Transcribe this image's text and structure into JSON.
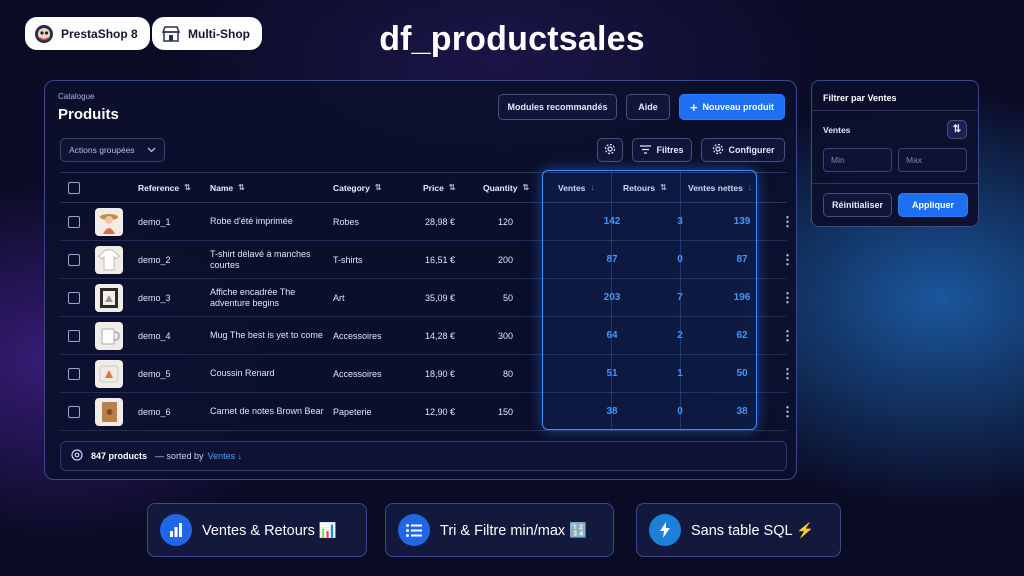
{
  "badges": [
    {
      "label": "PrestaShop 8",
      "icon": "prestashop-logo"
    },
    {
      "label": "Multi-Shop",
      "icon": "store-icon"
    }
  ],
  "main_title": "df_productsales",
  "panel": {
    "breadcrumb": "Catalogue",
    "title": "Produits",
    "buttons": {
      "modules": "Modules recommandés",
      "help": "Aide",
      "new_product": "Nouveau produit"
    },
    "bulk_actions": "Actions groupées",
    "toolbar": {
      "filters": "Filtres",
      "configure": "Configurer"
    }
  },
  "table": {
    "columns": [
      "Reference",
      "Name",
      "Category",
      "Price",
      "Quantity",
      "Ventes",
      "Retours",
      "Ventes nettes"
    ],
    "rows": [
      {
        "ref": "demo_1",
        "name": "Robe d'été imprimée",
        "category": "Robes",
        "price": "28,98 €",
        "qty": "120",
        "ventes": "142",
        "retours": "3",
        "nettes": "139",
        "thumb": "woman-hat"
      },
      {
        "ref": "demo_2",
        "name": "T-shirt délavé à manches courtes",
        "category": "T-shirts",
        "price": "16,51 €",
        "qty": "200",
        "ventes": "87",
        "retours": "0",
        "nettes": "87",
        "thumb": "tshirt"
      },
      {
        "ref": "demo_3",
        "name": "Affiche encadrée The adventure begins",
        "category": "Art",
        "price": "35,09 €",
        "qty": "50",
        "ventes": "203",
        "retours": "7",
        "nettes": "196",
        "thumb": "frame"
      },
      {
        "ref": "demo_4",
        "name": "Mug The best is yet to come",
        "category": "Accessoires",
        "price": "14,28 €",
        "qty": "300",
        "ventes": "64",
        "retours": "2",
        "nettes": "62",
        "thumb": "mug"
      },
      {
        "ref": "demo_5",
        "name": "Coussin Renard",
        "category": "Accessoires",
        "price": "18,90 €",
        "qty": "80",
        "ventes": "51",
        "retours": "1",
        "nettes": "50",
        "thumb": "cushion"
      },
      {
        "ref": "demo_6",
        "name": "Carnet de notes Brown Bear",
        "category": "Papeterie",
        "price": "12,90 €",
        "qty": "150",
        "ventes": "38",
        "retours": "0",
        "nettes": "38",
        "thumb": "notebook"
      }
    ]
  },
  "footer": {
    "count": "847 products",
    "sorted_prefix": "— sorted by",
    "sorted_by": "Ventes ↓"
  },
  "filter_panel": {
    "title": "Filtrer par Ventes",
    "label": "Ventes",
    "min_placeholder": "Min",
    "max_placeholder": "Max",
    "reset": "Réinitialiser",
    "apply": "Appliquer"
  },
  "features": [
    {
      "label": "Ventes & Retours 📊",
      "icon": "bar-chart-icon"
    },
    {
      "label": "Tri & Filtre min/max 🔢",
      "icon": "list-icon"
    },
    {
      "label": "Sans table SQL ⚡",
      "icon": "lightning-icon"
    }
  ],
  "colors": {
    "accent": "#1f6ff2",
    "highlight": "#4aa0ff"
  }
}
